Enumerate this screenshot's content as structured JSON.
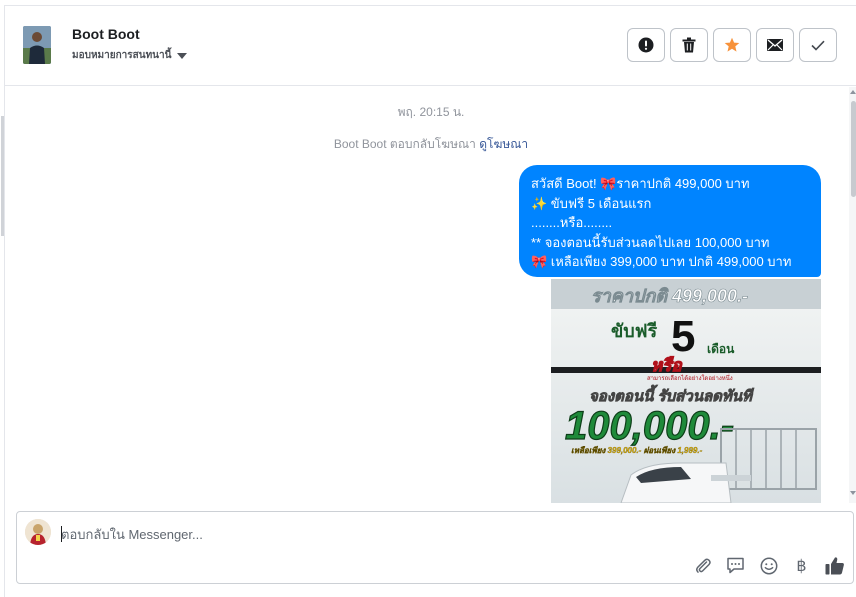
{
  "header": {
    "contact_name": "Boot Boot",
    "assign_label": "มอบหมายการสนทนานี้",
    "actions": [
      {
        "name": "mark-spam-button",
        "icon": "exclamation-circle-icon"
      },
      {
        "name": "delete-button",
        "icon": "trash-icon"
      },
      {
        "name": "star-button",
        "icon": "star-icon"
      },
      {
        "name": "mark-unread-button",
        "icon": "envelope-icon"
      },
      {
        "name": "mark-done-button",
        "icon": "check-icon"
      }
    ],
    "star_color": "#f7923b"
  },
  "thread": {
    "timestamp": "พฤ. 20:15 น.",
    "system_text": "Boot Boot ตอบกลับโฆษณา",
    "system_link": "ดูโฆษณา",
    "message_lines": [
      "สวัสดี Boot!  🎀ราคาปกติ 499,000 บาท",
      "✨ ขับฟรี 5 เดือนแรก",
      "........หรือ........",
      "** จองตอนนี้รับส่วนลดไปเลย 100,000 บาท",
      "🎀 เหลือเพียง 399,000 บาท ปกติ 499,000 บาท"
    ],
    "bubble_color": "#0084ff",
    "ad": {
      "line1": "ราคาปกติ 499,000.-",
      "line2_prefix": "ขับฟรี",
      "line2_number": "5",
      "line2_suffix": "เดือน",
      "or_label": "หรือ",
      "or_sub": "สามารถเลือกได้อย่างใดอย่างหนึ่ง",
      "line3": "จองตอนนี้ รับส่วนลดทันที",
      "line4": "100,000.-",
      "line5": "เหลือเพียง 399,000.- ผ่อนเพียง 1,999.-"
    }
  },
  "composer": {
    "placeholder": "ตอบกลับใน Messenger...",
    "tools": [
      "paperclip-icon",
      "speech-bubble-icon",
      "smiley-icon",
      "baht-icon",
      "thumbs-up-icon"
    ],
    "baht_symbol": "฿"
  }
}
